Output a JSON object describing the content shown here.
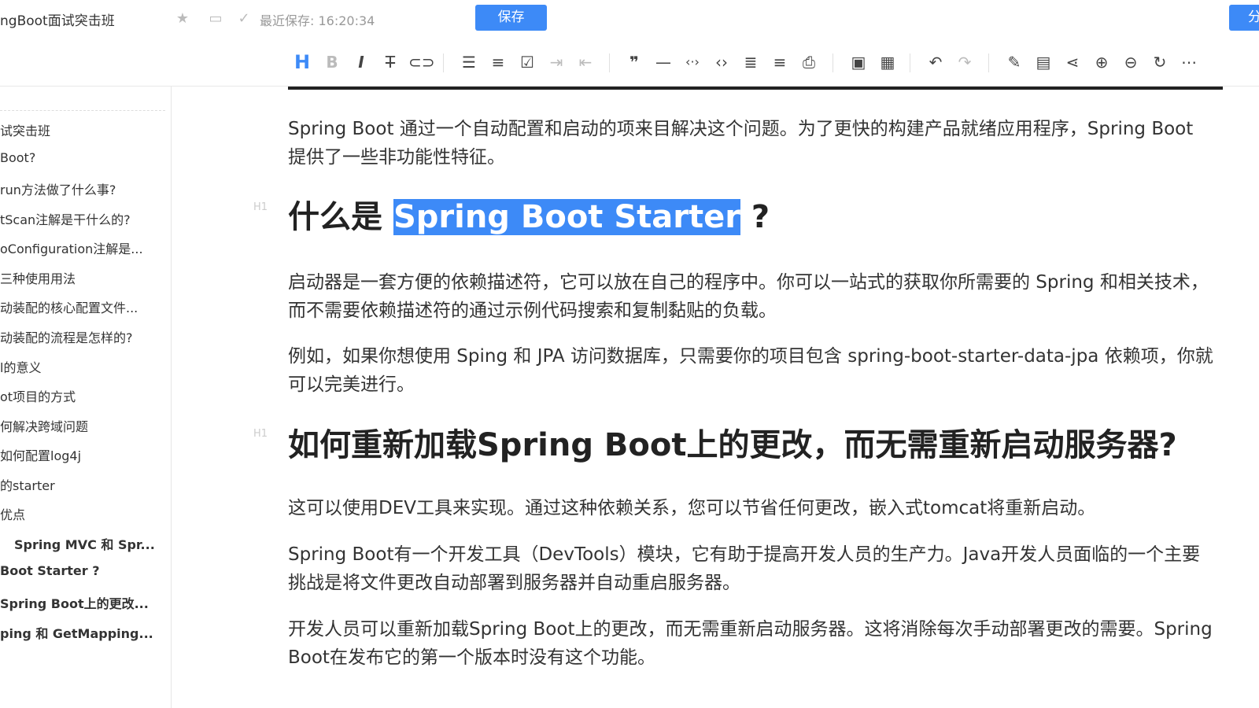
{
  "header": {
    "doc_title": "ngBoot面试突击班",
    "save_status": "最近保存: 16:20:34",
    "save_label": "保存",
    "share_label": "分"
  },
  "toolbar": {
    "icons": [
      "heading-icon",
      "bold-icon",
      "italic-icon",
      "strikethrough-icon",
      "link-icon",
      "bullet-list-icon",
      "ordered-list-icon",
      "checkbox-list-icon",
      "indent-icon",
      "outdent-icon",
      "quote-icon",
      "horizontal-rule-icon",
      "inline-code-icon",
      "code-block-icon",
      "table-of-contents-icon",
      "align-icon",
      "print-icon",
      "image-icon",
      "table-icon",
      "undo-icon",
      "redo-icon",
      "edit-icon",
      "preview-icon",
      "mindmap-icon",
      "zoom-in-icon",
      "zoom-out-icon",
      "refresh-icon",
      "more-icon"
    ]
  },
  "sidebar": {
    "items": [
      {
        "label": "试突击班",
        "bold": false
      },
      {
        "label": "Boot?",
        "bold": false
      },
      {
        "label": "run方法做了什么事?",
        "bold": false
      },
      {
        "label": "tScan注解是干什么的?",
        "bold": false
      },
      {
        "label": "oConfiguration注解是...",
        "bold": false
      },
      {
        "label": "三种使用用法",
        "bold": false
      },
      {
        "label": "动装配的核心配置文件...",
        "bold": false
      },
      {
        "label": "动装配的流程是怎样的?",
        "bold": false
      },
      {
        "label": "l的意义",
        "bold": false
      },
      {
        "label": "ot项目的方式",
        "bold": false
      },
      {
        "label": "何解决跨域问题",
        "bold": false
      },
      {
        "label": "如何配置log4j",
        "bold": false
      },
      {
        "label": "的starter",
        "bold": false
      },
      {
        "label": "优点",
        "bold": false
      },
      {
        "label": "Spring MVC 和 Spr...",
        "bold": true
      },
      {
        "label": "Boot Starter ?",
        "bold": true
      },
      {
        "label": "Spring Boot上的更改...",
        "bold": true
      },
      {
        "label": "ping 和 GetMapping...",
        "bold": true
      }
    ]
  },
  "content": {
    "p1": "Spring Boot 通过一个自动配置和启动的项来目解决这个问题。为了更快的构建产品就绪应用程序，Spring Boot 提供了一些非功能性特征。",
    "h1_label": "H1",
    "h1a_pre": "什么是 ",
    "h1a_highlight": "Spring Boot Starter",
    "h1a_post": " ?",
    "p2": "启动器是一套方便的依赖描述符，它可以放在自己的程序中。你可以一站式的获取你所需要的 Spring 和相关技术，而不需要依赖描述符的通过示例代码搜索和复制黏贴的负载。",
    "p3": "例如，如果你想使用 Sping 和 JPA 访问数据库，只需要你的项目包含 spring-boot-starter-data-jpa 依赖项，你就可以完美进行。",
    "h2_label": "H1",
    "h1b": "如何重新加载Spring Boot上的更改，而无需重新启动服务器?",
    "p4": "这可以使用DEV工具来实现。通过这种依赖关系，您可以节省任何更改，嵌入式tomcat将重新启动。",
    "p5": "Spring Boot有一个开发工具（DevTools）模块，它有助于提高开发人员的生产力。Java开发人员面临的一个主要挑战是将文件更改自动部署到服务器并自动重启服务器。",
    "p6": "开发人员可以重新加载Spring Boot上的更改，而无需重新启动服务器。这将消除每次手动部署更改的需要。Spring Boot在发布它的第一个版本时没有这个功能。"
  },
  "colors": {
    "accent": "#3d8af7",
    "highlight": "#3d8af7",
    "text": "#333333"
  }
}
